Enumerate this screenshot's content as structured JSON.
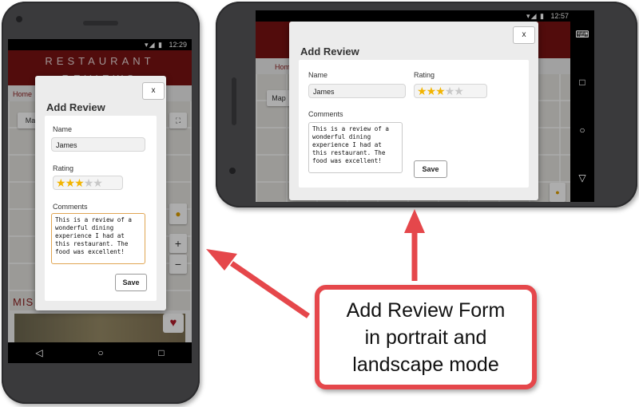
{
  "portrait": {
    "status_time": "12:29",
    "app_header": "RESTAURANT REVIEWS",
    "breadcrumb": "Home",
    "map_type_label": "Ma",
    "section_heading": "MIS",
    "nav_icons": [
      "back-icon",
      "home-icon",
      "recents-icon"
    ]
  },
  "landscape": {
    "status_time": "12:57",
    "breadcrumb": "Hom",
    "map_type_label": "Map",
    "nav_icons": [
      "keyboard-icon",
      "recents-icon",
      "home-icon",
      "back-icon"
    ]
  },
  "form": {
    "title": "Add Review",
    "close_label": "x",
    "name_label": "Name",
    "name_value": "James",
    "rating_label": "Rating",
    "rating": 3,
    "rating_max": 5,
    "comments_label": "Comments",
    "comments_value": "This is a review of a\nwonderful dining\nexperience I had at\nthis restaurant. The\nfood was excellent!",
    "save_label": "Save"
  },
  "callout": {
    "lines": [
      "Add Review Form",
      "in portrait and",
      "landscape mode"
    ]
  },
  "colors": {
    "arrow": "#e5474b",
    "header_bg": "#7a1212",
    "star_on": "#f2b400",
    "star_off": "#c8c8c8"
  }
}
